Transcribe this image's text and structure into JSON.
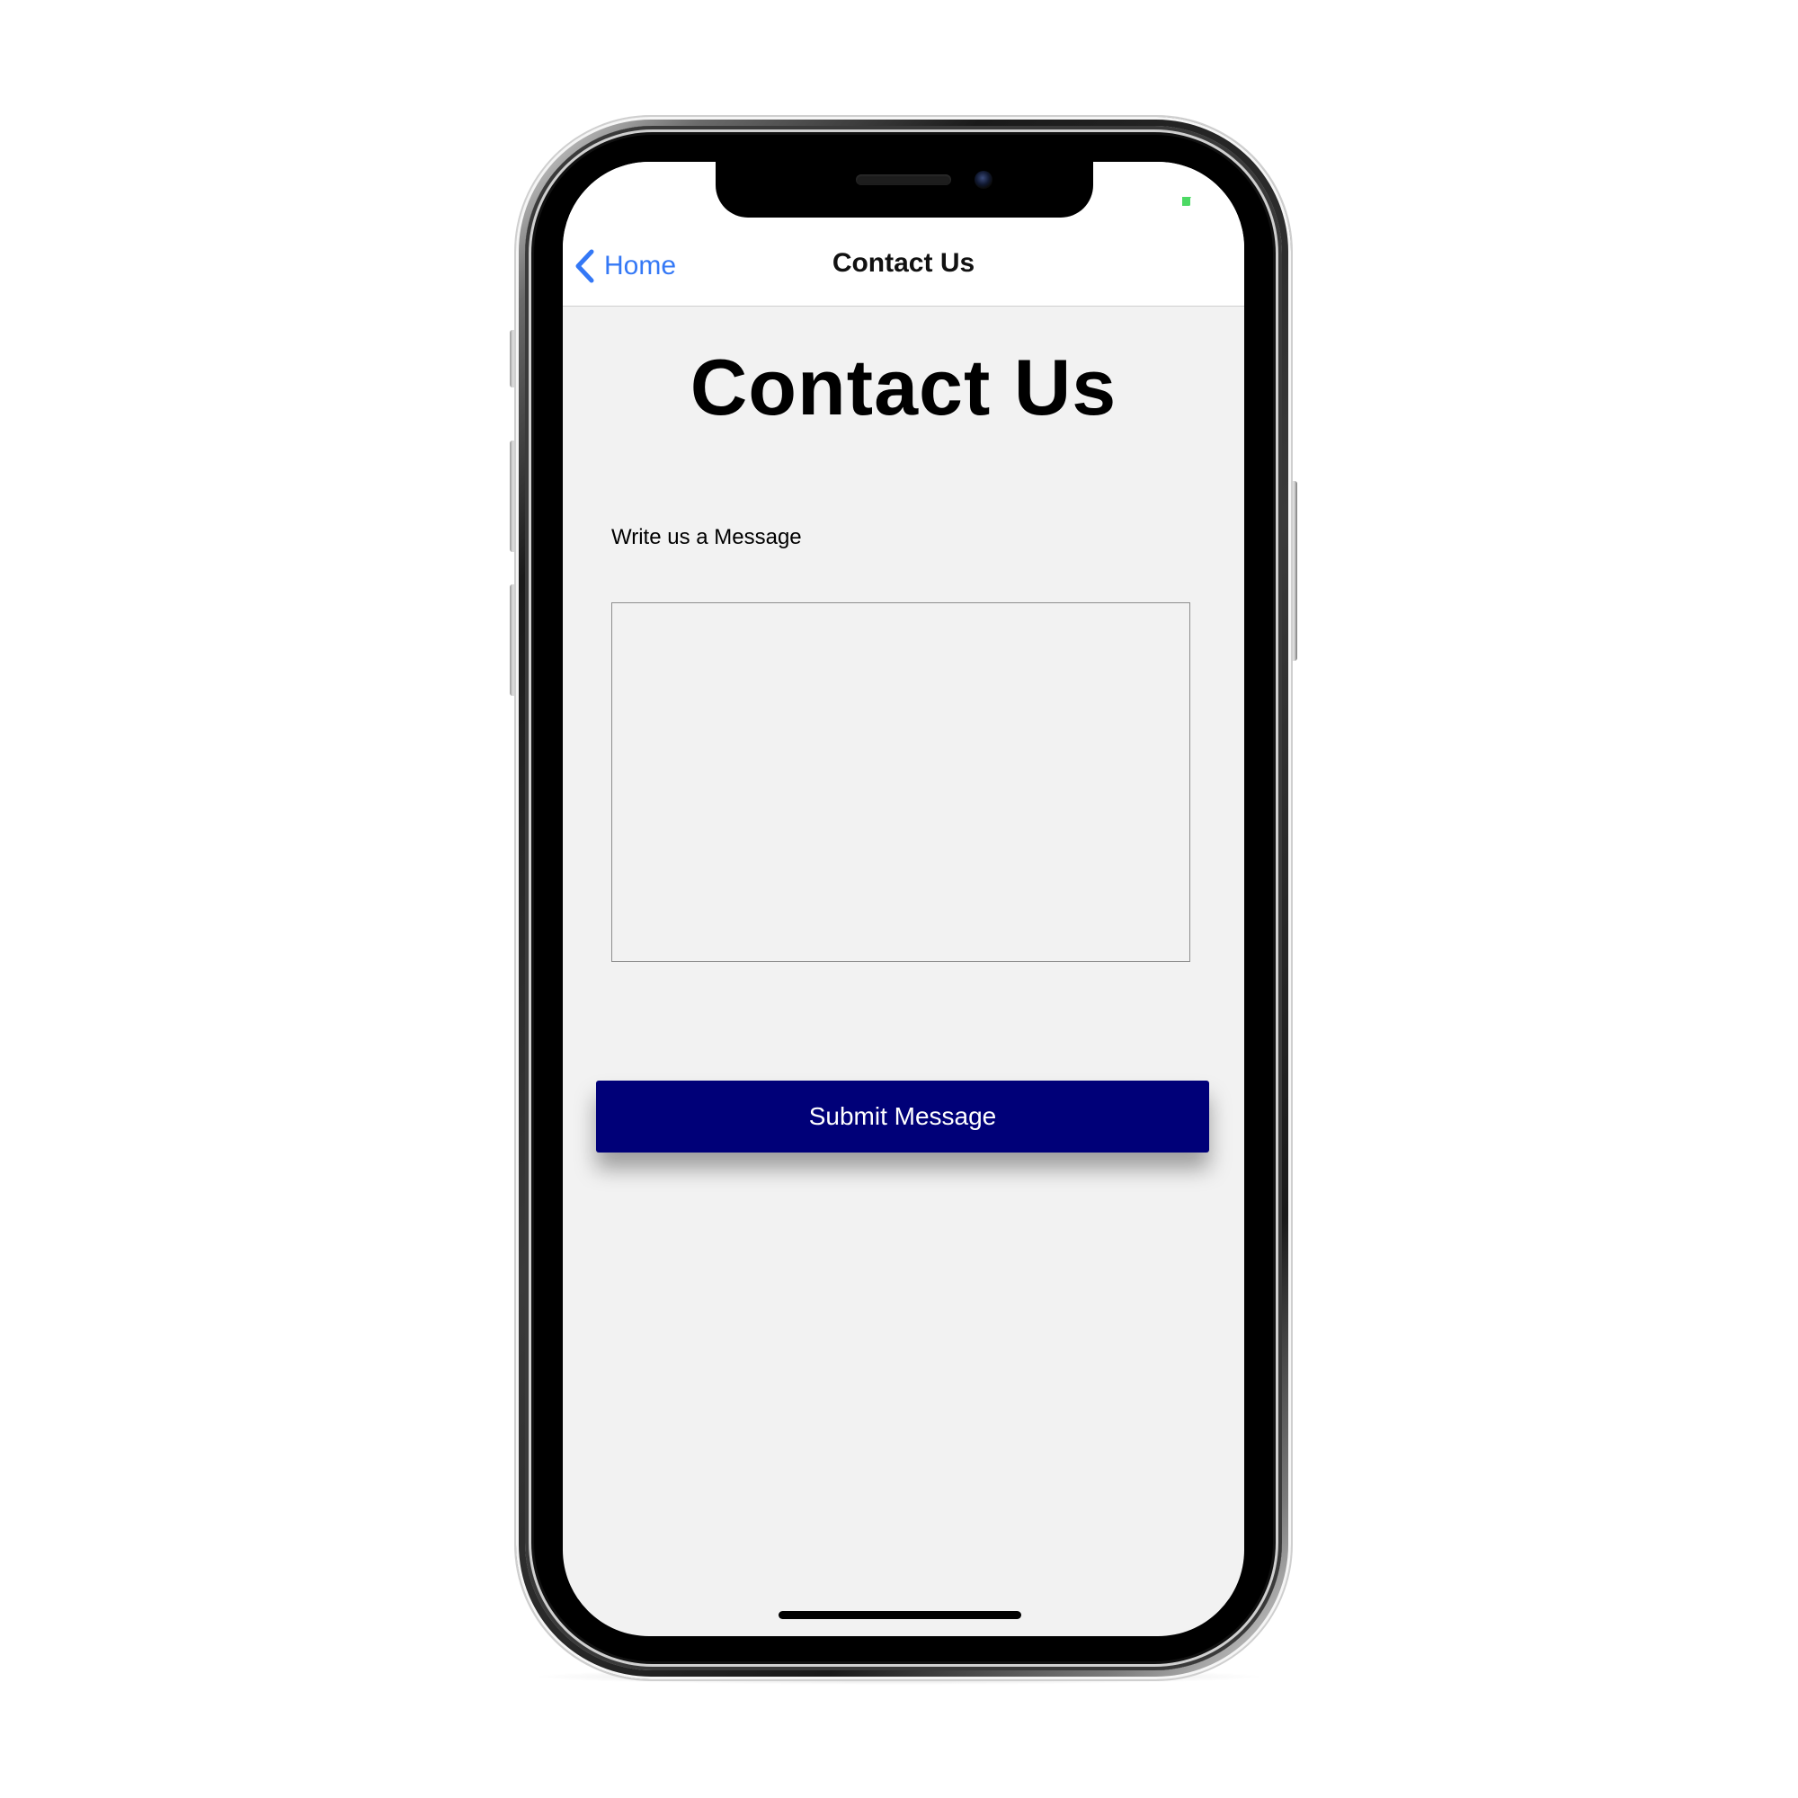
{
  "nav": {
    "back_label": "Home",
    "title": "Contact Us"
  },
  "page": {
    "heading": "Contact Us",
    "message_label": "Write us a Message",
    "message_value": "",
    "submit_label": "Submit Message"
  },
  "colors": {
    "accent": "#3478f6",
    "button_bg": "#000078",
    "battery": "#4cd964",
    "screen_bg": "#f2f2f2"
  },
  "icons": {
    "back": "chevron-left-icon",
    "battery": "battery-icon"
  }
}
